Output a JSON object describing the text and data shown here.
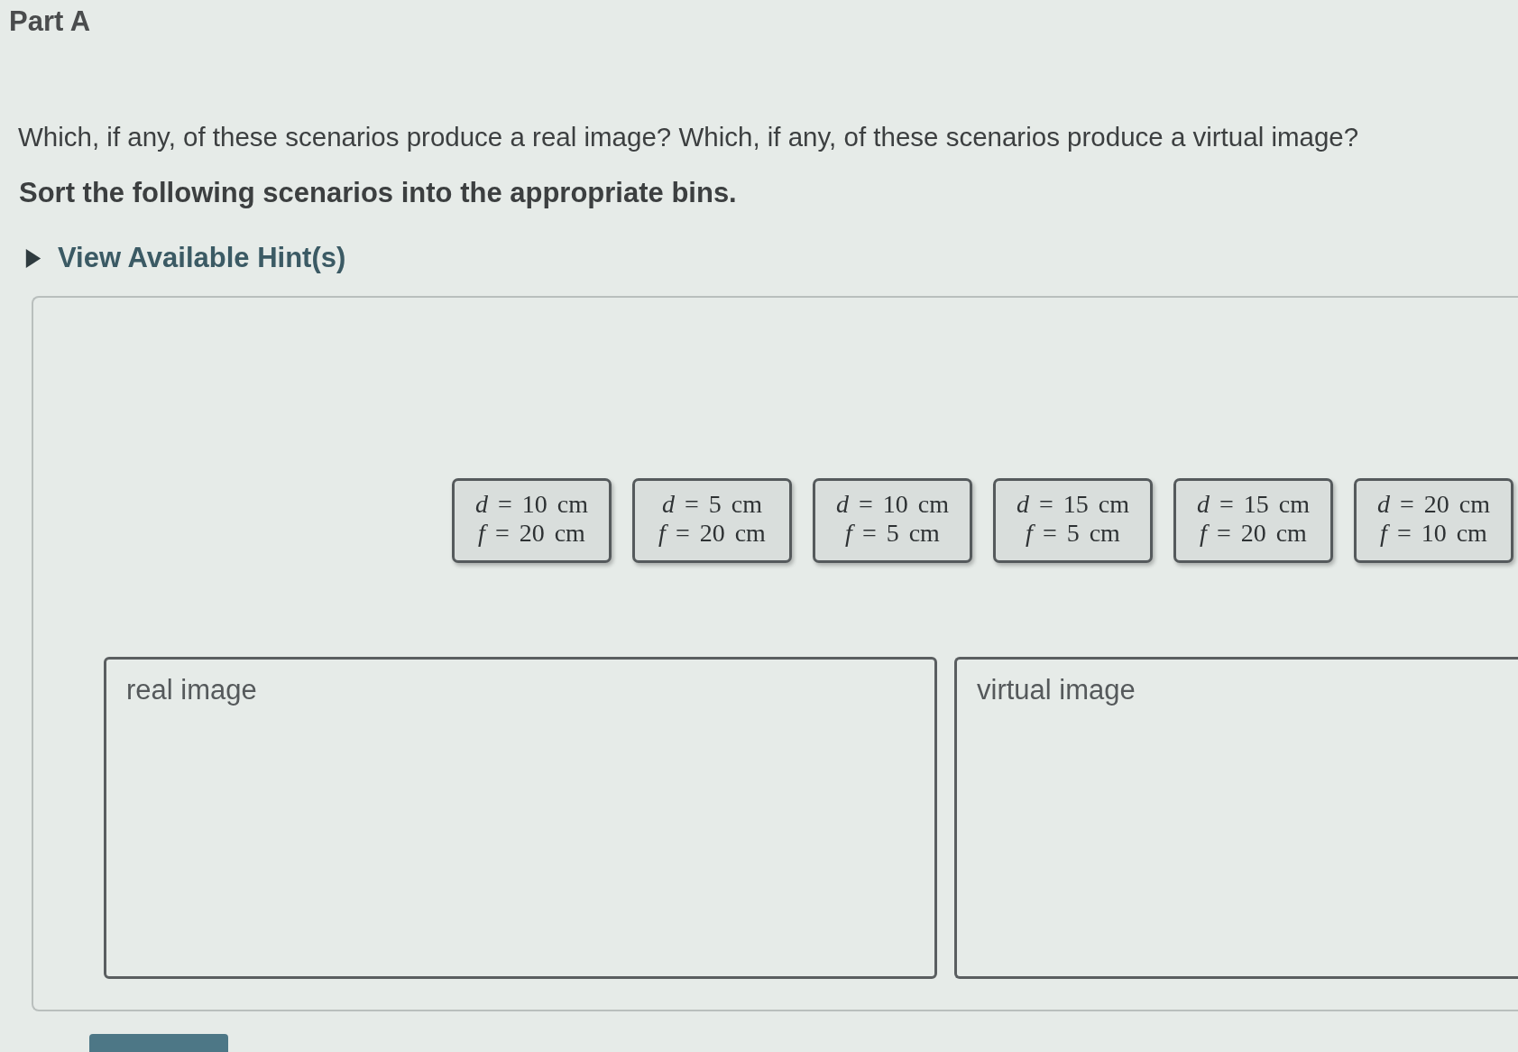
{
  "part_title": "Part A",
  "question": "Which, if any, of these scenarios produce a real image? Which, if any, of these scenarios produce a virtual image?",
  "instruction": "Sort the following scenarios into the appropriate bins.",
  "hint_toggle": {
    "label": "View Available Hint(s)",
    "expanded": false
  },
  "scenario_cards": [
    {
      "lines": [
        "*d* = 10 cm",
        "*f* = 20 cm"
      ]
    },
    {
      "lines": [
        "*d* = 5 cm",
        "*f* = 20 cm"
      ]
    },
    {
      "lines": [
        "*d* = 10 cm",
        "*f* = 5 cm"
      ]
    },
    {
      "lines": [
        "*d* = 15 cm",
        "*f* = 5 cm"
      ]
    },
    {
      "lines": [
        "*d* = 15 cm",
        "*f* = 20 cm"
      ]
    },
    {
      "lines": [
        "*d* = 20 cm",
        "*f* = 10 cm"
      ]
    }
  ],
  "bins": [
    {
      "label": "real image"
    },
    {
      "label": "virtual image"
    }
  ]
}
